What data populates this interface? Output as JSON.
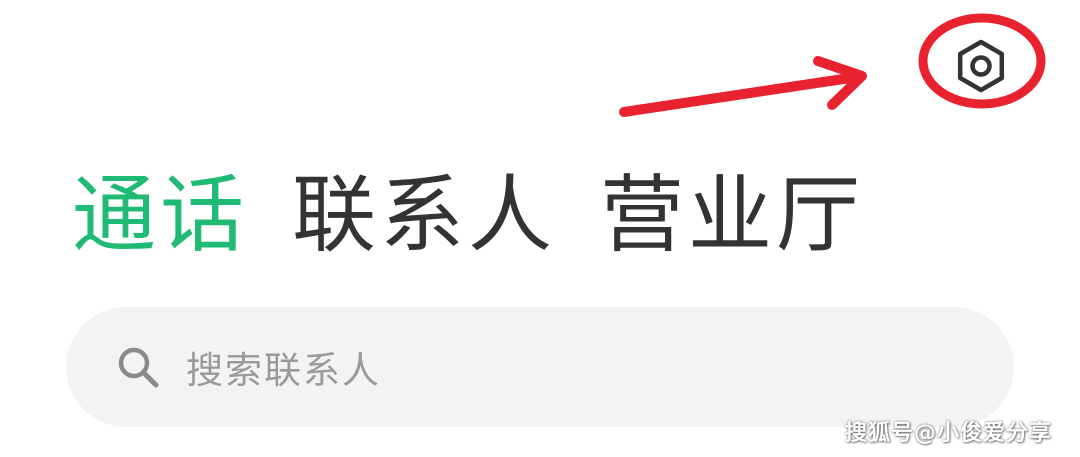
{
  "header": {
    "settings_icon": "hexagon-gear-icon"
  },
  "tabs": [
    {
      "label": "通话",
      "active": true
    },
    {
      "label": "联系人",
      "active": false
    },
    {
      "label": "营业厅",
      "active": false
    }
  ],
  "search": {
    "placeholder": "搜索联系人",
    "icon": "search-icon"
  },
  "watermark": "搜狐号@小俊爱分享",
  "colors": {
    "accent": "#1fba74",
    "annotation_red": "#e8232f",
    "tab_inactive": "#333333",
    "search_bg": "#f3f3f3",
    "placeholder": "#9a9a9a"
  }
}
